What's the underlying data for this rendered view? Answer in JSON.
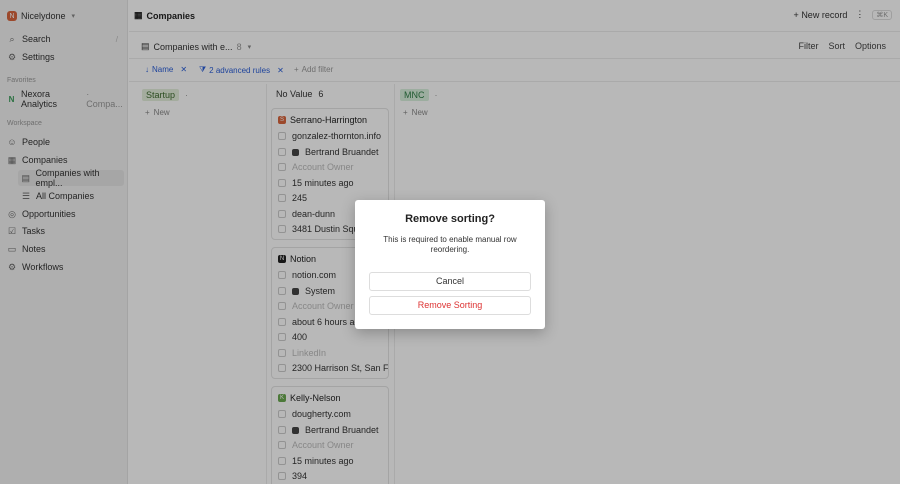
{
  "workspace": {
    "name": "Nicelydone",
    "logo_letter": "N"
  },
  "sidebar": {
    "search": "Search",
    "search_shortcut": "/",
    "settings": "Settings",
    "favorites_heading": "Favorites",
    "favorite": {
      "name": "Nexora Analytics",
      "suffix": "· Compa..."
    },
    "workspace_heading": "Workspace",
    "items": [
      {
        "label": "People"
      },
      {
        "label": "Companies"
      },
      {
        "label": "Companies with empl..."
      },
      {
        "label": "All Companies"
      },
      {
        "label": "Opportunities"
      },
      {
        "label": "Tasks"
      },
      {
        "label": "Notes"
      },
      {
        "label": "Workflows"
      }
    ]
  },
  "topbar": {
    "title": "Companies",
    "new_record": "New record",
    "shortcut": "⌘K"
  },
  "viewbar": {
    "view_name": "Companies with e...",
    "count": "8",
    "actions": [
      "Filter",
      "Sort",
      "Options"
    ]
  },
  "filterbar": {
    "sort_chip": "Name",
    "rules_chip": "2 advanced rules",
    "add_filter": "Add filter"
  },
  "columns": [
    {
      "label": "Startup",
      "tag_color": "#e4efdc",
      "text_color": "#3d6b2e",
      "new": "New"
    },
    {
      "label": "No Value",
      "count": "6"
    },
    {
      "label": "MNC",
      "tag_color": "#d8f0dd",
      "text_color": "#2e7d45",
      "new": "New"
    }
  ],
  "cards": [
    {
      "name": "Serrano-Harrington",
      "icon_color": "#d9663e",
      "icon_letter": "S",
      "domain": "gonzalez-thornton.info",
      "owner": "Bertrand Bruandet",
      "owner_ph": "Account Owner",
      "created": "15 minutes ago",
      "employees": "245",
      "handle": "dean-dunn",
      "address": "3481 Dustin Squa..."
    },
    {
      "name": "Notion",
      "icon_color": "#222222",
      "icon_letter": "N",
      "domain": "notion.com",
      "owner": "System",
      "owner_ph": "Account Owner",
      "created": "about 6 hours ago",
      "employees": "400",
      "handle": "LinkedIn",
      "address": "2300 Harrison St, San F..."
    },
    {
      "name": "Kelly-Nelson",
      "icon_color": "#6aa84f",
      "icon_letter": "K",
      "domain": "dougherty.com",
      "owner": "Bertrand Bruandet",
      "owner_ph": "Account Owner",
      "created": "15 minutes ago",
      "employees": "394"
    }
  ],
  "modal": {
    "title": "Remove sorting?",
    "body": "This is required to enable manual row reordering.",
    "cancel": "Cancel",
    "confirm": "Remove Sorting"
  }
}
